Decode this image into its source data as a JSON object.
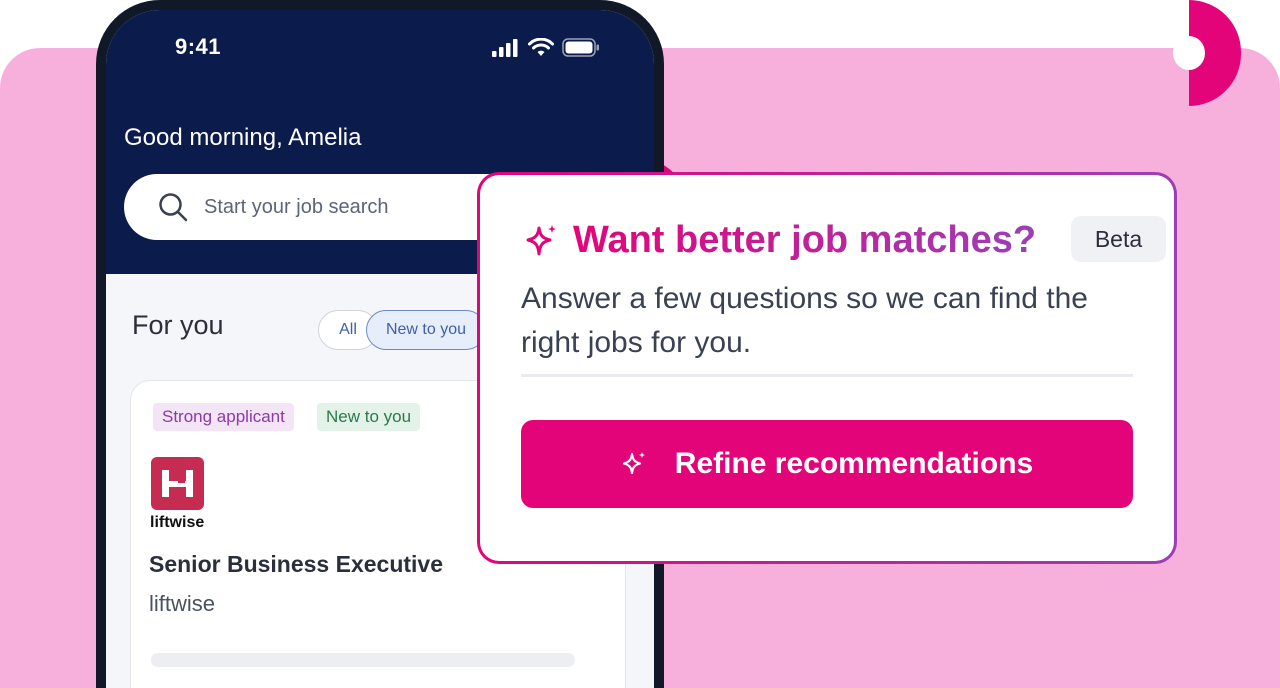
{
  "phone": {
    "status_time": "9:41",
    "greeting": "Good morning, Amelia",
    "search": {
      "placeholder": "Start your job search"
    },
    "section_title": "For you",
    "filters": [
      {
        "label": "All",
        "selected": false
      },
      {
        "label": "New to you",
        "selected": true
      }
    ],
    "job_card": {
      "tags": [
        "Strong applicant",
        "New to you"
      ],
      "company_logo_text": "liftwise",
      "title": "Senior Business Executive",
      "company": "liftwise"
    }
  },
  "popup": {
    "title": "Want better job matches?",
    "badge": "Beta",
    "description": "Answer a few questions so we can find the right jobs for you.",
    "button_label": "Refine recommendations"
  },
  "colors": {
    "brand_pink": "#e3047a",
    "brand_purple": "#9c3fb6",
    "background_pink": "#f7b0dc",
    "navy": "#0a1b4c"
  },
  "icons": [
    "search-icon",
    "signal-icon",
    "wifi-icon",
    "battery-icon",
    "sparkle-icon"
  ]
}
